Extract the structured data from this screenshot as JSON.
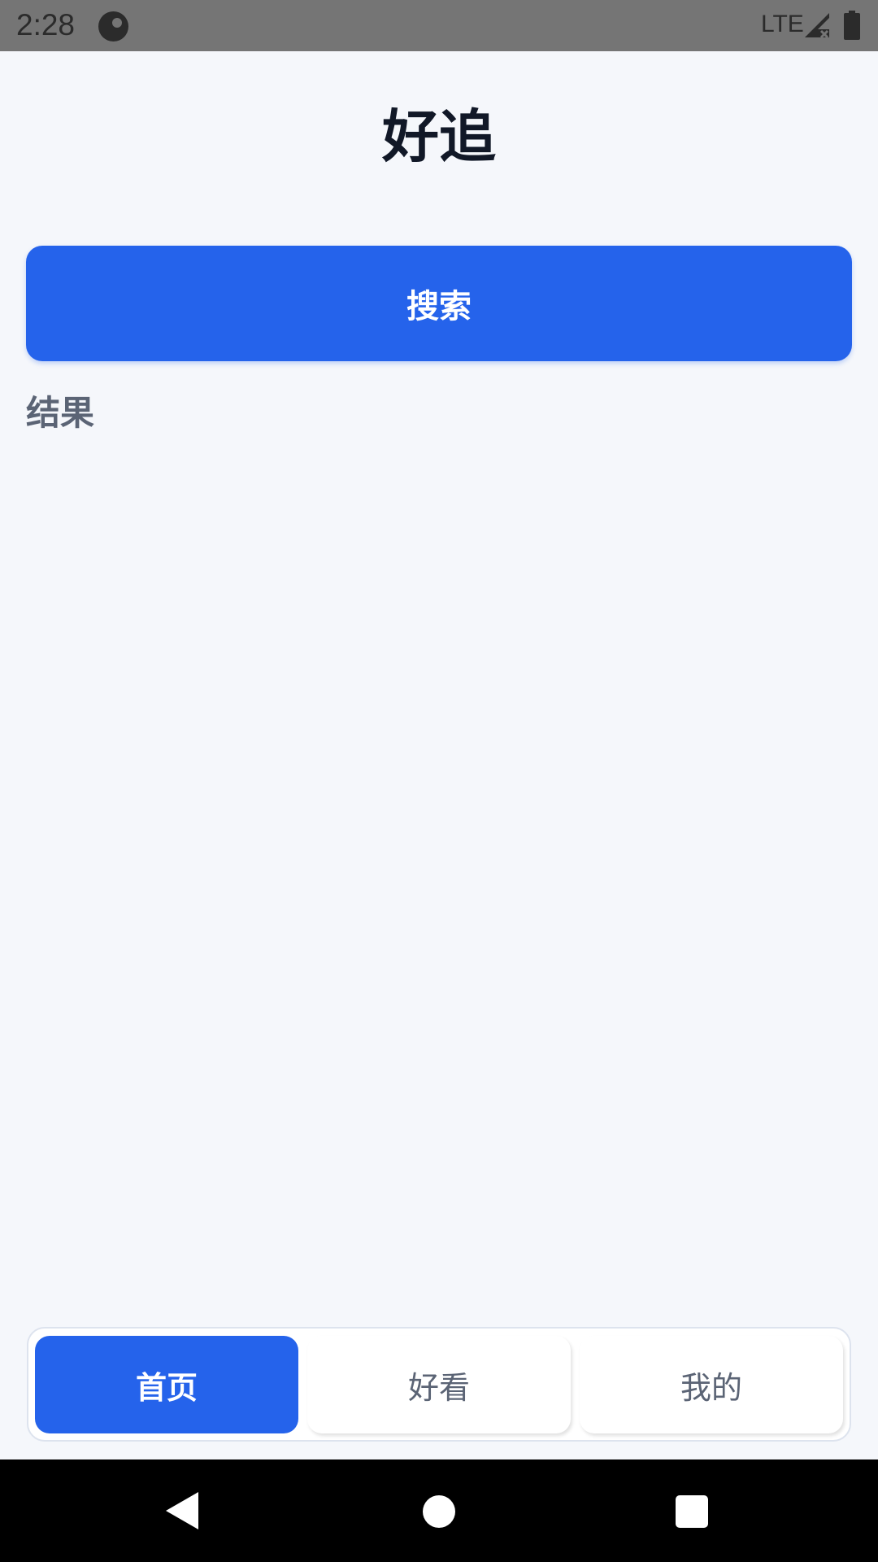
{
  "status_bar": {
    "time": "2:28",
    "network": "LTE",
    "icons": [
      "app-notification-icon",
      "signal-icon",
      "battery-icon"
    ]
  },
  "app": {
    "title": "好追"
  },
  "search": {
    "button_label": "搜索"
  },
  "results": {
    "label": "结果"
  },
  "tabs": [
    {
      "label": "首页",
      "active": true
    },
    {
      "label": "好看",
      "active": false
    },
    {
      "label": "我的",
      "active": false
    }
  ],
  "colors": {
    "accent": "#2563eb",
    "background": "#f5f7fb",
    "title_text": "#111827",
    "muted_text": "#5b6475"
  },
  "nav_bar": {
    "icons": [
      "back-icon",
      "home-icon",
      "recents-icon"
    ]
  }
}
